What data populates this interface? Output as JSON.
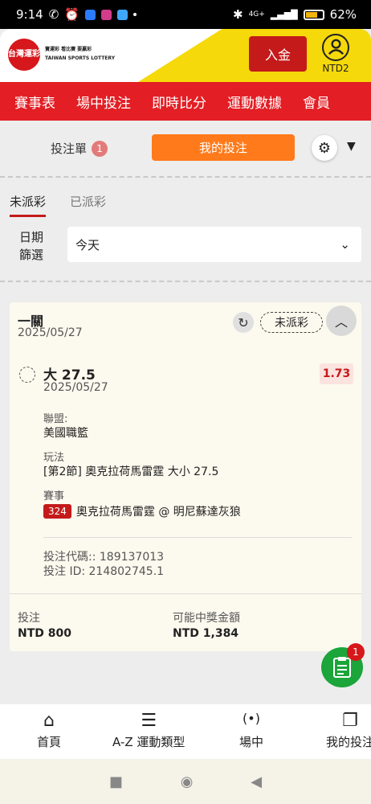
{
  "status_bar": {
    "time": "9:14",
    "network": "4G+",
    "battery": "62%"
  },
  "header": {
    "logo_text": "台灣運彩",
    "brand_lines": [
      "寶運彩 看比賽 要贏彩",
      "TAIWAN SPORTS LOTTERY"
    ],
    "deposit_label": "入金",
    "account_label": "NTD2"
  },
  "nav": {
    "items": [
      "賽事表",
      "場中投注",
      "即時比分",
      "運動數據",
      "會員"
    ]
  },
  "betslip_tabs": {
    "betslip_label": "投注單",
    "betslip_count": "1",
    "mybets_label": "我的投注"
  },
  "subtabs": {
    "unsettled": "未派彩",
    "settled": "已派彩"
  },
  "date_filter": {
    "label_line1": "日期",
    "label_line2": "篩選",
    "value": "今天"
  },
  "bet": {
    "type": "一關",
    "date": "2025/05/27",
    "status": "未派彩",
    "selection": "大 27.5",
    "selection_date": "2025/05/27",
    "odds": "1.73",
    "league_label": "聯盟:",
    "league": "美國職籃",
    "market_label": "玩法",
    "market": "[第2節] 奧克拉荷馬雷霆 大小 27.5",
    "event_label": "賽事",
    "event_no": "324",
    "event": "奧克拉荷馬雷霆 @ 明尼蘇達灰狼",
    "bet_code": "投注代碼:: 189137013",
    "bet_id": "投注 ID: 214802745.1",
    "stake_label": "投注",
    "stake": "NTD 800",
    "payout_label": "可能中獎金額",
    "payout": "NTD 1,384"
  },
  "fab": {
    "count": "1"
  },
  "bottom_nav": {
    "home": "首頁",
    "az": "A-Z 運動類型",
    "live": "場中",
    "mybets": "我的投注"
  },
  "colors": {
    "brand_red": "#e31e24",
    "accent_orange": "#ff7a1a",
    "fab_green": "#1ba53a",
    "header_yellow": "#f5d90a"
  }
}
